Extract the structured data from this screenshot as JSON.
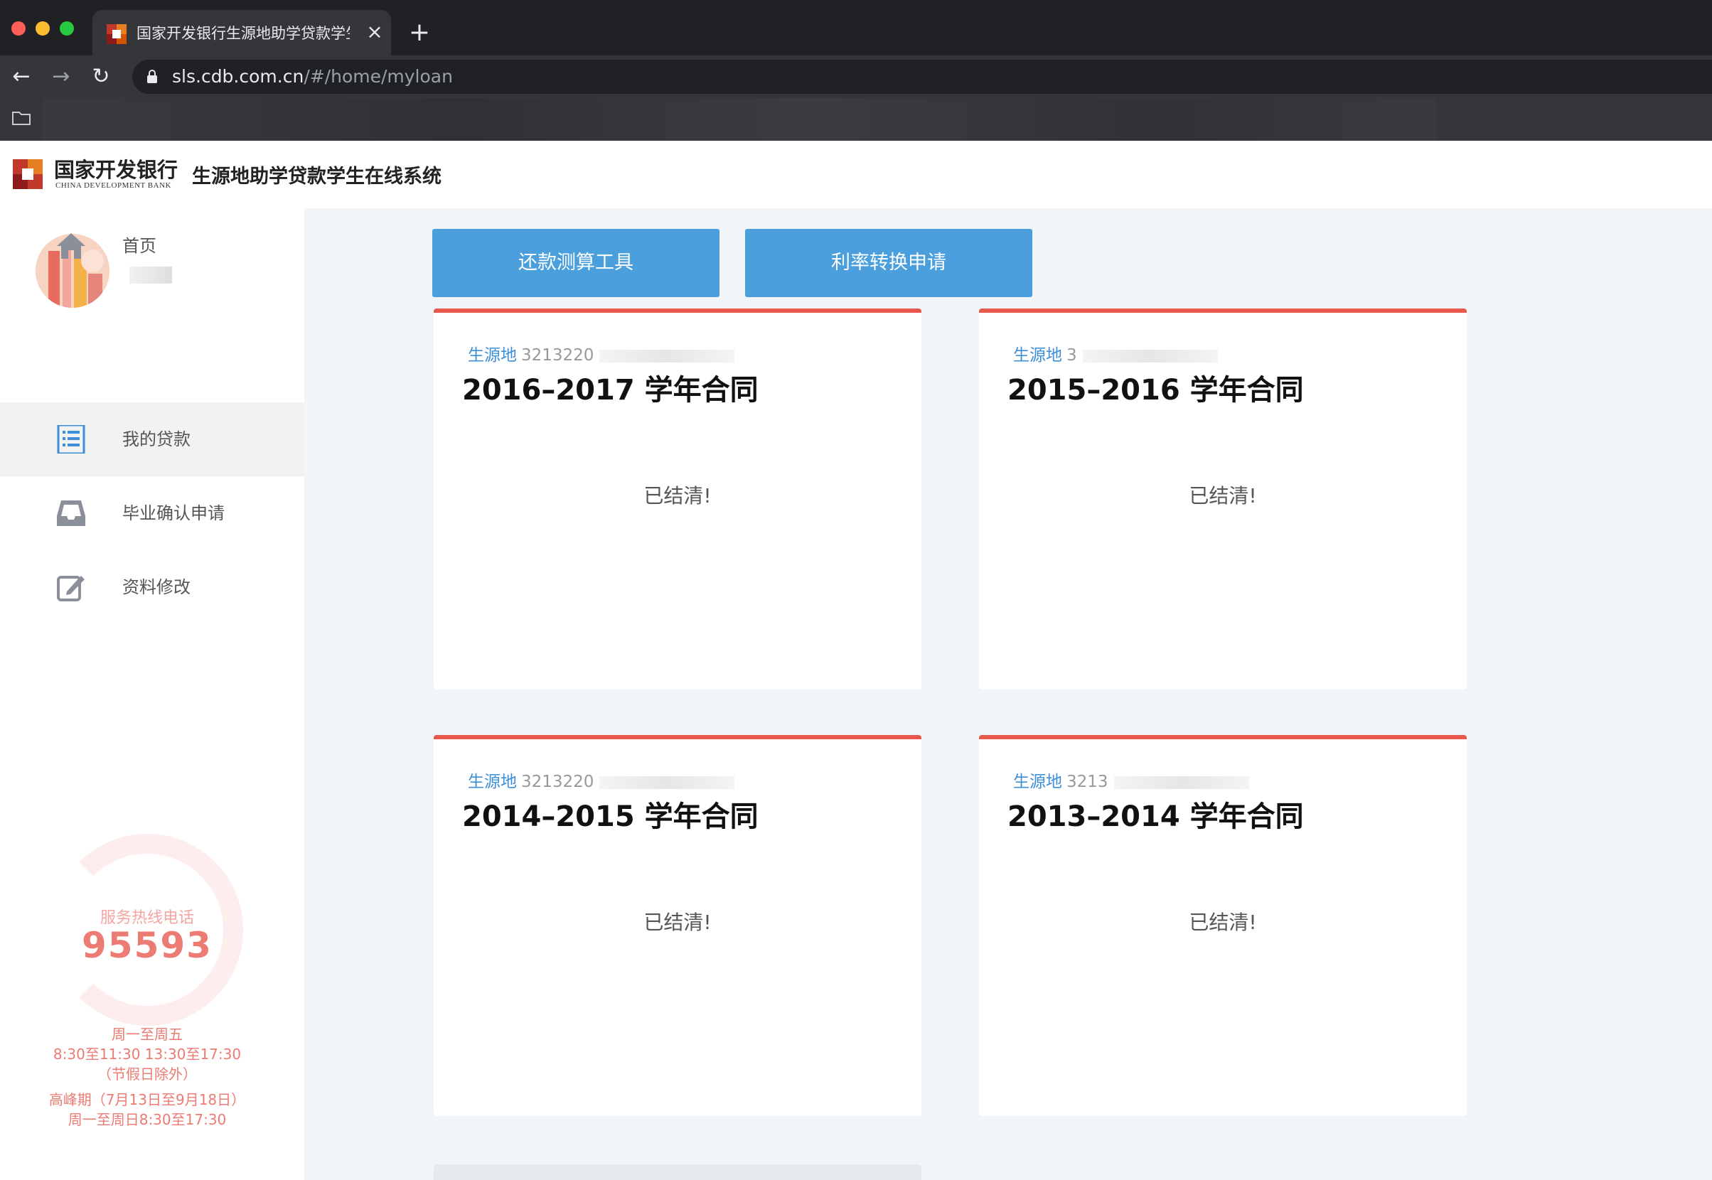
{
  "browser": {
    "tab_title": "国家开发银行生源地助学贷款学生在线系统",
    "tab_close": "×",
    "new_tab": "+",
    "back": "←",
    "forward": "→",
    "reload": "↻",
    "url_host": "sls.cdb.com.cn",
    "url_path": "/#/home/myloan"
  },
  "header": {
    "bank_name_cn": "国家开发银行",
    "bank_name_en": "CHINA DEVELOPMENT BANK",
    "system_title": "生源地助学贷款学生在线系统"
  },
  "sidebar": {
    "items": [
      {
        "label": "首页",
        "icon": "home-icon"
      },
      {
        "label": "我的贷款",
        "icon": "list-icon",
        "active": true
      },
      {
        "label": "毕业确认申请",
        "icon": "inbox-icon"
      },
      {
        "label": "资料修改",
        "icon": "edit-icon"
      }
    ],
    "hotline": {
      "label": "服务热线电话",
      "number": "95593",
      "hours": [
        "周一至周五",
        "8:30至11:30  13:30至17:30",
        "（节假日除外）",
        "高峰期（7月13日至9月18日）",
        "周一至周日8:30至17:30"
      ]
    }
  },
  "main": {
    "buttons": [
      {
        "label": "还款测算工具"
      },
      {
        "label": "利率转换申请"
      }
    ],
    "cards": [
      {
        "source": "生源地",
        "id": "3213220",
        "title": "2016–2017 学年合同",
        "status": "已结清!"
      },
      {
        "source": "生源地",
        "id": "3",
        "title": "2015–2016 学年合同",
        "status": "已结清!"
      },
      {
        "source": "生源地",
        "id": "3213220",
        "title": "2014–2015 学年合同",
        "status": "已结清!"
      },
      {
        "source": "生源地",
        "id": "3213",
        "title": "2013–2014 学年合同",
        "status": "已结清!"
      }
    ]
  },
  "colors": {
    "accent_blue": "#4a9fdc",
    "card_top_red": "#e8584c",
    "hotline_red": "#ec7b73"
  }
}
